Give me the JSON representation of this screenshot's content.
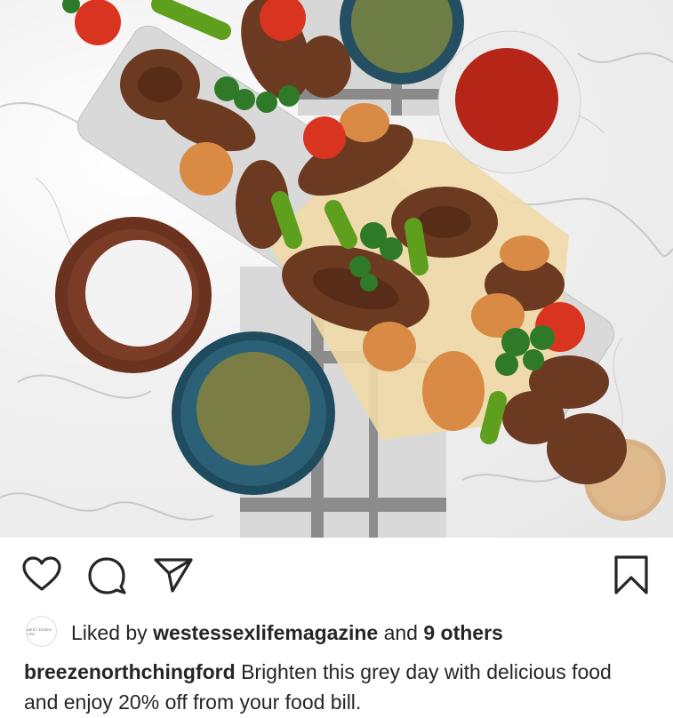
{
  "post": {
    "image": {
      "subject": "Mixed grill platter with lamb chops, chicken, peppers, tomatoes and spice bowls"
    },
    "actions": {
      "like_icon": "heart-icon",
      "comment_icon": "comment-bubble-icon",
      "share_icon": "paper-plane-icon",
      "save_icon": "bookmark-icon"
    },
    "likes": {
      "avatar_text": "WEST ESSEX LIFE",
      "prefix": "Liked by",
      "user": "westessexlifemagazine",
      "middle": "and",
      "others": "9 others"
    },
    "caption": {
      "username": "breezenorthchingford",
      "text": "Brighten this grey day with delicious food and enjoy 20% off from your food bill."
    },
    "colors": {
      "text": "#262626",
      "icon": "#262626"
    }
  }
}
